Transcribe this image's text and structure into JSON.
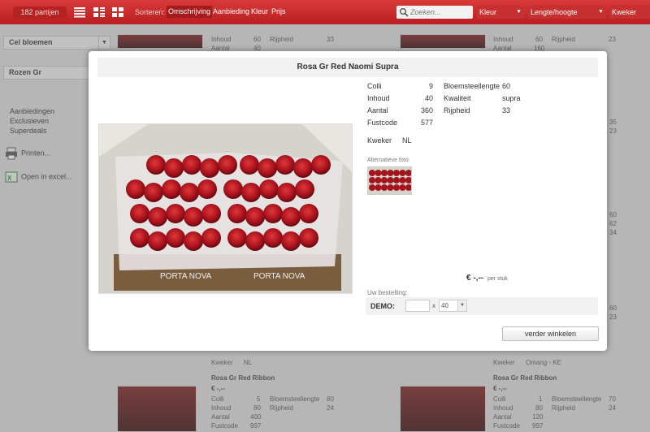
{
  "toolbar": {
    "count_label": "182 partijen",
    "sort_label": "Sorteren:",
    "sort_options": [
      "Omschrijving",
      "Aanbieding",
      "Kleur",
      "Prijs"
    ],
    "search_placeholder": "Zoeken...",
    "kleur_label": "Kleur",
    "lengte_label": "Lengte/hoogte",
    "kweker_label": "Kweker",
    "accent_color": "#c62828"
  },
  "sidebar": {
    "category": "Cel bloemen",
    "subcategory": "Rozen Gr",
    "links": [
      "Aanbiedingen",
      "Exclusieven",
      "Superdeals"
    ],
    "print_label": "Printen...",
    "excel_label": "Open in excel..."
  },
  "background": {
    "top_left": {
      "inhoud_label": "Inhoud",
      "inhoud": "60",
      "rijpheid_label": "Rijpheid",
      "rijpheid": "33",
      "aantal_label": "Aantal",
      "aantal": "40"
    },
    "top_right": {
      "inhoud_label": "Inhoud",
      "inhoud": "60",
      "rijpheid_label": "Rijpheid",
      "rijpheid": "23",
      "aantal_label": "Aantal",
      "aantal": "160"
    },
    "edge_numbers": [
      "35",
      "23",
      "60",
      "62",
      "34",
      "60",
      "23"
    ],
    "kweker_left": {
      "label": "Kweker",
      "value": "NL"
    },
    "kweker_right": {
      "label": "Kweker",
      "value": "Omang - KE"
    },
    "card_left": {
      "title": "Rosa Gr Red Ribbon",
      "price": "€ -,--",
      "colli_label": "Colli",
      "colli": "5",
      "bloem_label": "Bloemsteellengte",
      "bloem": "80",
      "inhoud_label": "Inhoud",
      "inhoud": "80",
      "rijpheid_label": "Rijpheid",
      "rijpheid": "24",
      "aantal_label": "Aantal",
      "aantal": "400",
      "fust_label": "Fustcode",
      "fust": "997"
    },
    "card_right": {
      "title": "Rosa Gr Red Ribbon",
      "price": "€ -,--",
      "colli_label": "Colli",
      "colli": "1",
      "bloem_label": "Bloemsteellengte",
      "bloem": "70",
      "inhoud_label": "Inhoud",
      "inhoud": "80",
      "rijpheid_label": "Rijpheid",
      "rijpheid": "24",
      "aantal_label": "Aantal",
      "aantal": "120",
      "fust_label": "Fustcode",
      "fust": "997"
    }
  },
  "modal": {
    "title": "Rosa Gr Red Naomi Supra",
    "colli_label": "Colli",
    "colli": "9",
    "inhoud_label": "Inhoud",
    "inhoud": "40",
    "aantal_label": "Aantal",
    "aantal": "360",
    "fust_label": "Fustcode",
    "fust": "577",
    "bloem_label": "Bloemsteellengte",
    "bloem": "60",
    "kwaliteit_label": "Kwaliteit",
    "kwaliteit": "supra",
    "rijpheid_label": "Rijpheid",
    "rijpheid": "33",
    "kweker_label": "Kweker",
    "kweker": "NL",
    "alt_label": "Alternatieve foto:",
    "photo_text": "PORTA NOVA",
    "price": "€ -,--",
    "price_unit": "per stuk",
    "order_label": "Uw bestelling:",
    "demo_label": "DEMO:",
    "qty_value": "",
    "times": "x",
    "pack_option": "40",
    "continue_label": "verder winkelen"
  }
}
